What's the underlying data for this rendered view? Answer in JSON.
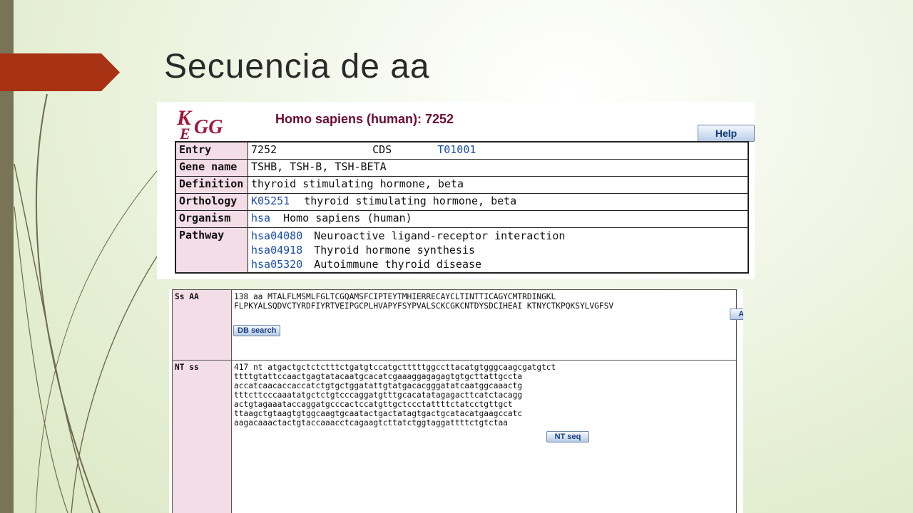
{
  "slide": {
    "title": "Secuencia de aa"
  },
  "kegg": {
    "logo_text": "KEGG",
    "heading": "Homo sapiens (human): 7252",
    "help_label": "Help",
    "rows": {
      "entry": {
        "label": "Entry",
        "id": "7252",
        "type": "CDS",
        "genome": "T01001"
      },
      "gene_name": {
        "label": "Gene name",
        "value": "TSHB, TSH-B, TSH-BETA"
      },
      "definition": {
        "label": "Definition",
        "value": "thyroid stimulating hormone, beta"
      },
      "orthology": {
        "label": "Orthology",
        "id": "K05251",
        "value": "thyroid stimulating hormone, beta"
      },
      "organism": {
        "label": "Organism",
        "id": "hsa",
        "value": "Homo sapiens (human)"
      },
      "pathway": {
        "label": "Pathway",
        "items": [
          {
            "id": "hsa04080",
            "name": "Neuroactive ligand-receptor interaction"
          },
          {
            "id": "hsa04918",
            "name": "Thyroid hormone synthesis"
          },
          {
            "id": "hsa05320",
            "name": "Autoimmune thyroid disease"
          }
        ]
      }
    }
  },
  "sequences": {
    "aa": {
      "label": "Ss AA",
      "lines": [
        "138 aa MTALFLMSMLFGLTCGQAMSFCIPTEYTMHIERRECAYCLTINTTICAGYCMTRDINGKL",
        "FLPKYALSQDVCTYRDFIYRTVEIPGCPLHVAPYFSYPVALSCKCGKCNTDYSDCIHEAI KTNYCTKPQKSYLVGFSV"
      ],
      "seq_button": "AA seq",
      "search_button": "DB search"
    },
    "nt": {
      "label": "NT ss",
      "lines": [
        "417 nt atgactgctctctttctgatgtccatgctttttggccttacatgtgggcaagcgatgtct",
        "ttttgtattccaactgagtatacaatgcacatcgaaaggagagagtgtgcttattgccta",
        "accatcaacaccaccatctgtgctggatattgtatgacacgggatatcaatggcaaactg",
        "tttcttcccaaatatgctctgtcccaggatgtttgcacatatagagacttcatctacagg",
        "actgtagaaataccaggatgcccactccatgttgctccctattttctatcctgttgct",
        "ttaagctgtaagtgtggcaagtgcaatactgactatagtgactgcatacatgaagccatc",
        "aagacaaactactgtaccaaacctcagaagtcttatctggtaggattttctgtctaa"
      ],
      "seq_button": "NT seq"
    }
  }
}
